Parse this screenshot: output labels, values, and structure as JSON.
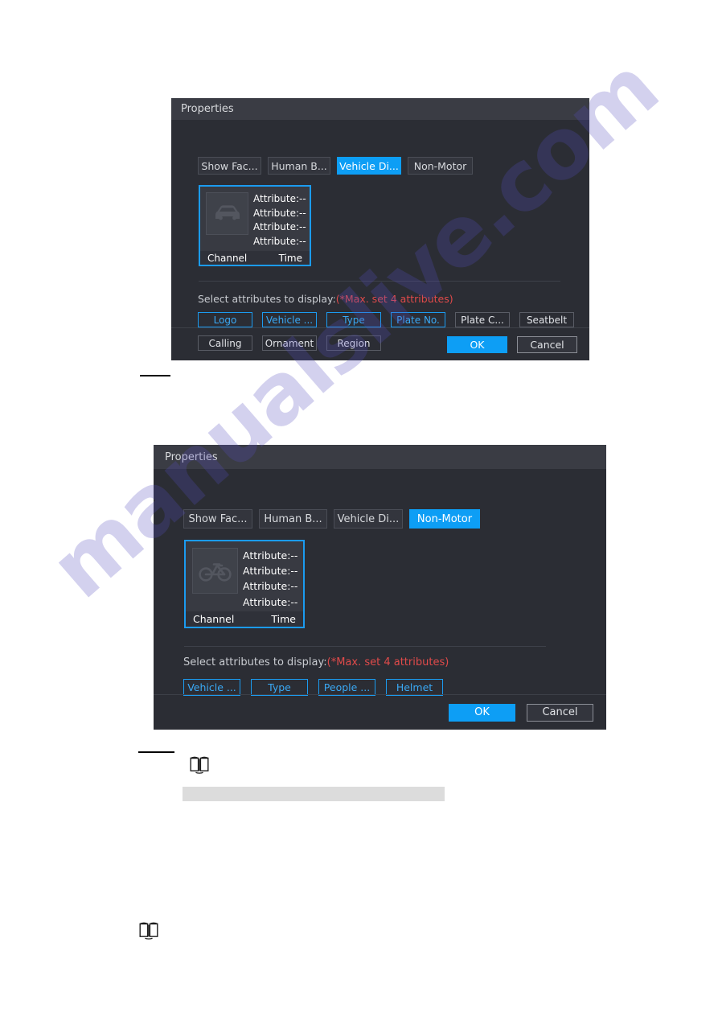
{
  "page": {
    "watermark_text": "manualslive.com"
  },
  "dialog_vehicle": {
    "title": "Properties",
    "tabs": [
      {
        "label": "Show Fac...",
        "active": false
      },
      {
        "label": "Human B...",
        "active": false
      },
      {
        "label": "Vehicle Di...",
        "active": true
      },
      {
        "label": "Non-Motor",
        "active": false
      }
    ],
    "preview": {
      "icon": "car-icon",
      "attributes": [
        "Attribute:--",
        "Attribute:--",
        "Attribute:--",
        "Attribute:--"
      ],
      "footer_left": "Channel",
      "footer_right": "Time"
    },
    "hint_label": "Select attributes to display:",
    "hint_warning": "(*Max. set 4 attributes)",
    "chips_row1": [
      {
        "label": "Logo",
        "selected": true
      },
      {
        "label": "Vehicle ...",
        "selected": true
      },
      {
        "label": "Type",
        "selected": true
      },
      {
        "label": "Plate No.",
        "selected": true
      },
      {
        "label": "Plate C...",
        "selected": false
      },
      {
        "label": "Seatbelt",
        "selected": false
      }
    ],
    "chips_row2": [
      {
        "label": "Calling",
        "selected": false
      },
      {
        "label": "Ornament",
        "selected": false
      },
      {
        "label": "Region",
        "selected": false
      }
    ],
    "ok_label": "OK",
    "cancel_label": "Cancel"
  },
  "dialog_nonmotor": {
    "title": "Properties",
    "tabs": [
      {
        "label": "Show Fac...",
        "active": false
      },
      {
        "label": "Human B...",
        "active": false
      },
      {
        "label": "Vehicle Di...",
        "active": false
      },
      {
        "label": "Non-Motor",
        "active": true
      }
    ],
    "preview": {
      "icon": "bicycle-icon",
      "attributes": [
        "Attribute:--",
        "Attribute:--",
        "Attribute:--",
        "Attribute:--"
      ],
      "footer_left": "Channel",
      "footer_right": "Time"
    },
    "hint_label": "Select attributes to display:",
    "hint_warning": "(*Max. set 4 attributes)",
    "chips_row1": [
      {
        "label": "Vehicle ...",
        "selected": true
      },
      {
        "label": "Type",
        "selected": true
      },
      {
        "label": "People ...",
        "selected": true
      },
      {
        "label": "Helmet",
        "selected": true
      }
    ],
    "ok_label": "OK",
    "cancel_label": "Cancel"
  },
  "colors": {
    "accent": "#0d9ef5",
    "selected_border": "#1b9bf0",
    "warning": "#e04a4a",
    "dialog_bg": "#2b2d34",
    "titlebar_bg": "#3a3c44"
  }
}
